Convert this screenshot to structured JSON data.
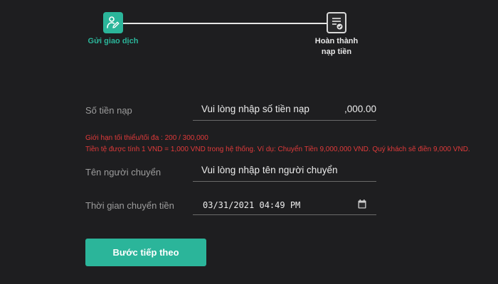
{
  "stepper": {
    "steps": [
      {
        "label": "Gửi giao dịch",
        "icon": "user-edit-icon",
        "active": true
      },
      {
        "label_line1": "Hoàn thành",
        "label_line2": "nạp tiền",
        "icon": "document-check-icon",
        "active": false
      }
    ]
  },
  "form": {
    "amount": {
      "label": "Số tiền nạp",
      "placeholder": "Vui lòng nhập số tiền nạp",
      "suffix": ",000.00"
    },
    "hints": {
      "limit": "Giới hạn tối thiểu/tối đa : 200 / 300,000",
      "conversion": "Tiền tệ được tính 1 VND = 1,000 VND trong hệ thống. Ví dụ: Chuyển Tiền 9,000,000 VND. Quý khách sẽ điền 9,000 VND."
    },
    "sender": {
      "label": "Tên người chuyển",
      "placeholder": "Vui lòng nhập tên người chuyển"
    },
    "transfer_time": {
      "label": "Thời gian chuyển tiền",
      "value": "03/31/2021 04:49 PM",
      "icon": "calendar-icon"
    }
  },
  "actions": {
    "next_label": "Bước tiếp theo"
  },
  "colors": {
    "accent": "#2bb59a",
    "error": "#e03a3a",
    "background": "#1e1e20"
  }
}
